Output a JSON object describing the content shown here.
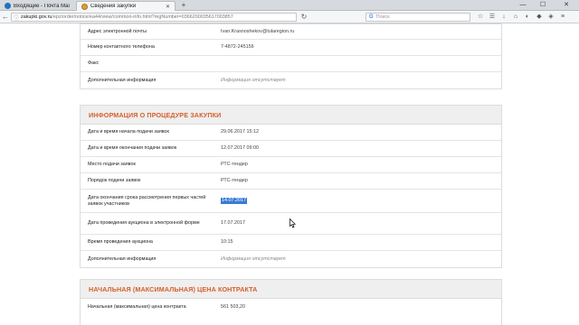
{
  "browser": {
    "tabs": [
      {
        "label": "Входящие - Почта Mail.Ru"
      },
      {
        "label": "Сведения закупки"
      }
    ],
    "new_tab": "+",
    "address": {
      "host": "zakupki.gov.ru",
      "path": "/epz/order/notice/ea44/view/common-info.html?regNumber=0366200035617003857"
    },
    "search_placeholder": "Поиск",
    "search_engine_glyph": "G",
    "window_controls": {
      "minimize": "—",
      "maximize": "☐",
      "close": "✕"
    }
  },
  "contacts": {
    "rows": [
      {
        "label": "Адрес электронной почты",
        "value": "Ivan.Krasnoshekov@tularegion.ru",
        "muted": false
      },
      {
        "label": "Номер контактного телефона",
        "value": "7-4872-245156",
        "muted": false
      },
      {
        "label": "Факс",
        "value": "",
        "muted": false
      },
      {
        "label": "Дополнительная информация",
        "value": "Информация отсутствует",
        "muted": true
      }
    ]
  },
  "procedure": {
    "title": "ИНФОРМАЦИЯ О ПРОЦЕДУРЕ ЗАКУПКИ",
    "rows": [
      {
        "label": "Дата и время начала подачи заявок",
        "value": "29.06.2017 15:12"
      },
      {
        "label": "Дата и время окончания подачи заявок",
        "value": "12.07.2017 09:00"
      },
      {
        "label": "Место подачи заявок",
        "value": "РТС-тендер"
      },
      {
        "label": "Порядок подачи заявок",
        "value": "РТС-тендер"
      },
      {
        "label": "Дата окончания срока рассмотрения первых частей заявок участников",
        "value": "14.07.2017"
      },
      {
        "label": "Дата проведения аукциона в электронной форме",
        "value": "17.07.2017"
      },
      {
        "label": "Время проведения аукциона",
        "value": "10:15"
      },
      {
        "label": "Дополнительная информация",
        "value": "Информация отсутствует"
      }
    ]
  },
  "price": {
    "title": "НАЧАЛЬНАЯ (МАКСИМАЛЬНАЯ) ЦЕНА КОНТРАКТА",
    "rows": [
      {
        "label": "Начальная (максимальная) цена контракта",
        "value": "561 503,20"
      }
    ]
  },
  "colors": {
    "section_title": "#d5602c",
    "selection": "#3a7bd5"
  }
}
